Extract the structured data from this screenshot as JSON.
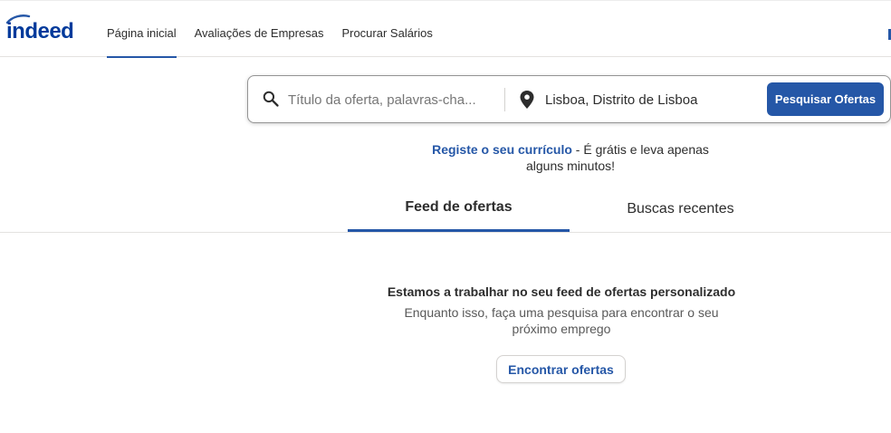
{
  "brand": {
    "logo_text": "indeed",
    "accent": "#2557a7"
  },
  "header": {
    "nav": [
      {
        "label": "Página inicial",
        "active": true
      },
      {
        "label": "Avaliações de Empresas",
        "active": false
      },
      {
        "label": "Procurar Salários",
        "active": false
      }
    ]
  },
  "search": {
    "what_placeholder": "Título da oferta, palavras-cha...",
    "what_value": "",
    "where_value": "Lisboa, Distrito de Lisboa",
    "button_label": "Pesquisar Ofertas",
    "icons": {
      "what": "search-icon",
      "where": "location-pin-icon"
    }
  },
  "promo": {
    "link_text": "Registe o seu currículo",
    "rest_text": " - É grátis e leva apenas alguns minutos!"
  },
  "tabs": [
    {
      "label": "Feed de ofertas",
      "active": true
    },
    {
      "label": "Buscas recentes",
      "active": false
    }
  ],
  "feed": {
    "title": "Estamos a trabalhar no seu feed de ofertas personalizado",
    "description": "Enquanto isso, faça uma pesquisa para encontrar o seu próximo emprego",
    "button_label": "Encontrar ofertas"
  }
}
